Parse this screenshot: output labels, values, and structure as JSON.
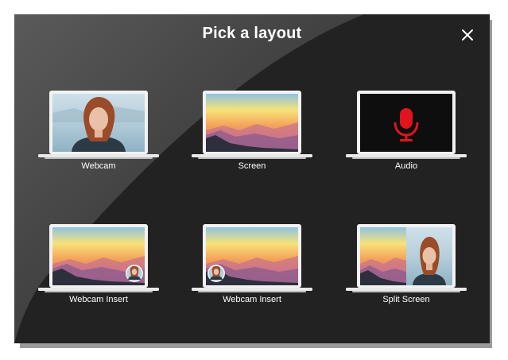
{
  "dialog": {
    "title": "Pick a layout",
    "close_icon": "close-icon"
  },
  "layouts": [
    {
      "label": "Webcam",
      "preview": "webcam"
    },
    {
      "label": "Screen",
      "preview": "screen"
    },
    {
      "label": "Audio",
      "preview": "audio",
      "icon": "microphone-icon",
      "icon_color": "#e0141e"
    },
    {
      "label": "Webcam Insert",
      "preview": "screen-webcam-bottom-right"
    },
    {
      "label": "Webcam Insert",
      "preview": "screen-webcam-bottom-left"
    },
    {
      "label": "Split Screen",
      "preview": "split-screen"
    }
  ],
  "colors": {
    "background": "#222222",
    "text": "#ffffff",
    "accent_red": "#e0141e"
  }
}
